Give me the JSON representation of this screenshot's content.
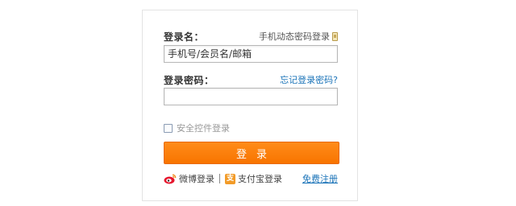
{
  "login": {
    "username_label": "登录名：",
    "phone_login": "手机动态密码登录",
    "username_placeholder": "手机号/会员名/邮箱",
    "password_label": "登录密码：",
    "forgot_password": "忘记登录密码?",
    "security_control": "安全控件登录",
    "submit": "登录",
    "weibo": "微博登录",
    "alipay": "支付宝登录",
    "alipay_mark": "支",
    "register": "免费注册"
  },
  "colors": {
    "primary_button": "#f87400",
    "link": "#1a73b8"
  }
}
